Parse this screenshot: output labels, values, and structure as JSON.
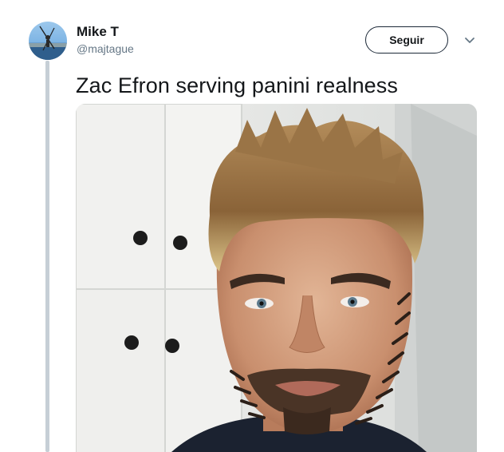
{
  "tweet": {
    "author_name": "Mike T",
    "author_handle": "@majtague",
    "follow_label": "Seguir",
    "text": "Zac Efron serving panini realness"
  },
  "icons": {
    "more": "chevron-down-icon"
  },
  "colors": {
    "text_primary": "#14171a",
    "text_secondary": "#657786",
    "thread_line": "#c6cfd6"
  }
}
